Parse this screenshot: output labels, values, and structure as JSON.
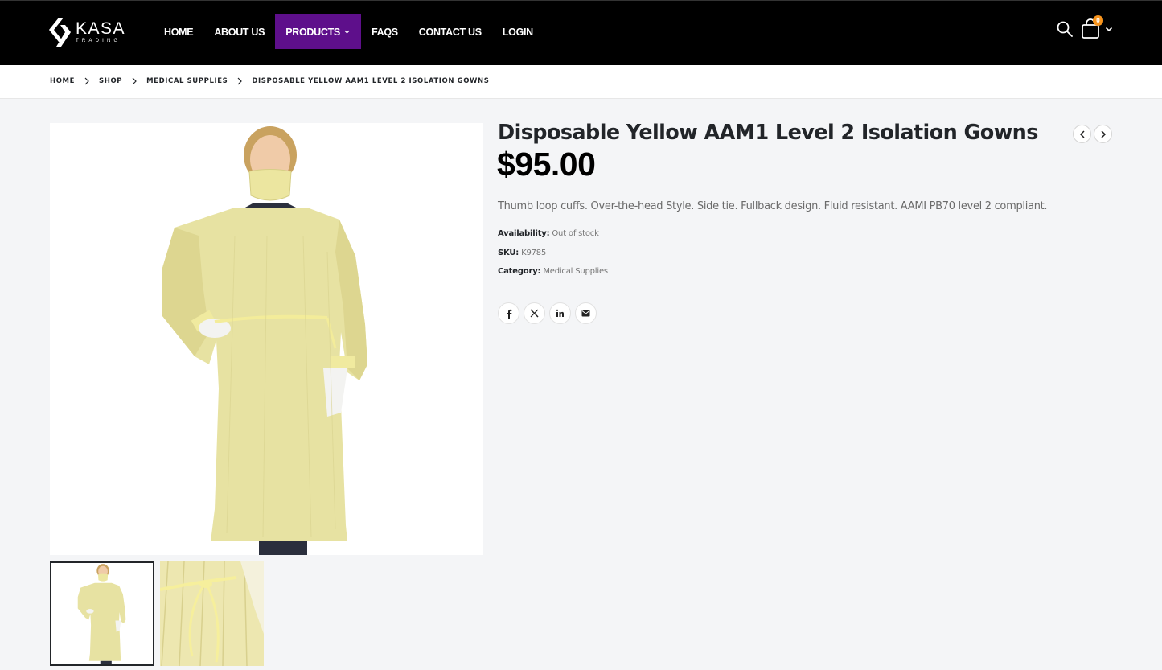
{
  "brand": {
    "name": "KASA",
    "tagline": "TRADING"
  },
  "nav": [
    {
      "label": "HOME"
    },
    {
      "label": "ABOUT US"
    },
    {
      "label": "PRODUCTS",
      "active": true
    },
    {
      "label": "FAQS"
    },
    {
      "label": "CONTACT US"
    },
    {
      "label": "LOGIN"
    }
  ],
  "header": {
    "cart_count": "0"
  },
  "breadcrumb": {
    "items": [
      "HOME",
      "SHOP",
      "MEDICAL SUPPLIES",
      "DISPOSABLE YELLOW AAM1 LEVEL 2 ISOLATION GOWNS"
    ]
  },
  "product": {
    "title": "Disposable Yellow AAM1 Level 2 Isolation Gowns",
    "price": "$95.00",
    "description": "Thumb loop cuffs. Over-the-head Style. Side tie. Fullback design. Fluid resistant. AAMI PB70 level 2 compliant.",
    "availability_label": "Availability:",
    "availability": "Out of stock",
    "sku_label": "SKU:",
    "sku": "K9785",
    "category_label": "Category:",
    "category": "Medical Supplies"
  },
  "share": [
    "facebook-icon",
    "x-icon",
    "linkedin-icon",
    "email-icon"
  ],
  "colors": {
    "header_bg": "#000000",
    "active_nav": "#5e0f8b",
    "badge": "#f7941d",
    "gown": "#e8e4a6"
  }
}
